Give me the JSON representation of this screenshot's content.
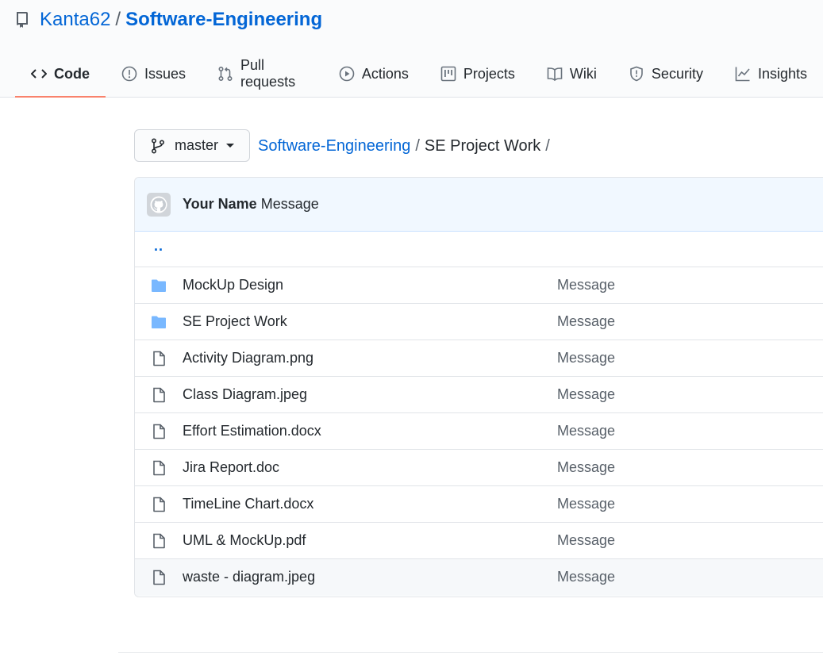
{
  "repo": {
    "owner": "Kanta62",
    "separator": "/",
    "name": "Software-Engineering"
  },
  "tabs": [
    {
      "label": "Code",
      "icon": "code-icon",
      "selected": true
    },
    {
      "label": "Issues",
      "icon": "issue-opened-icon"
    },
    {
      "label": "Pull requests",
      "icon": "git-pull-request-icon"
    },
    {
      "label": "Actions",
      "icon": "play-icon"
    },
    {
      "label": "Projects",
      "icon": "project-icon"
    },
    {
      "label": "Wiki",
      "icon": "book-icon"
    },
    {
      "label": "Security",
      "icon": "shield-icon"
    },
    {
      "label": "Insights",
      "icon": "graph-icon"
    }
  ],
  "branch": {
    "label": "master"
  },
  "breadcrumb": {
    "root": "Software-Engineering",
    "sep1": "/",
    "current": "SE Project Work",
    "sep2": "/"
  },
  "commit": {
    "author": "Your Name",
    "message": "Message"
  },
  "parent_link": "..",
  "files": [
    {
      "name": "MockUp Design",
      "type": "folder",
      "message": "Message"
    },
    {
      "name": "SE Project Work",
      "type": "folder",
      "message": "Message"
    },
    {
      "name": "Activity Diagram.png",
      "type": "file",
      "message": "Message"
    },
    {
      "name": "Class Diagram.jpeg",
      "type": "file",
      "message": "Message"
    },
    {
      "name": "Effort Estimation.docx",
      "type": "file",
      "message": "Message"
    },
    {
      "name": "Jira Report.doc",
      "type": "file",
      "message": "Message"
    },
    {
      "name": "TimeLine Chart.docx",
      "type": "file",
      "message": "Message"
    },
    {
      "name": "UML & MockUp.pdf",
      "type": "file",
      "message": "Message"
    },
    {
      "name": "waste - diagram.jpeg",
      "type": "file",
      "message": "Message"
    }
  ],
  "colors": {
    "link": "#0366d6",
    "tab_underline": "#f9826c",
    "folder": "#79b8ff",
    "commit_bar": "#f1f8ff"
  }
}
